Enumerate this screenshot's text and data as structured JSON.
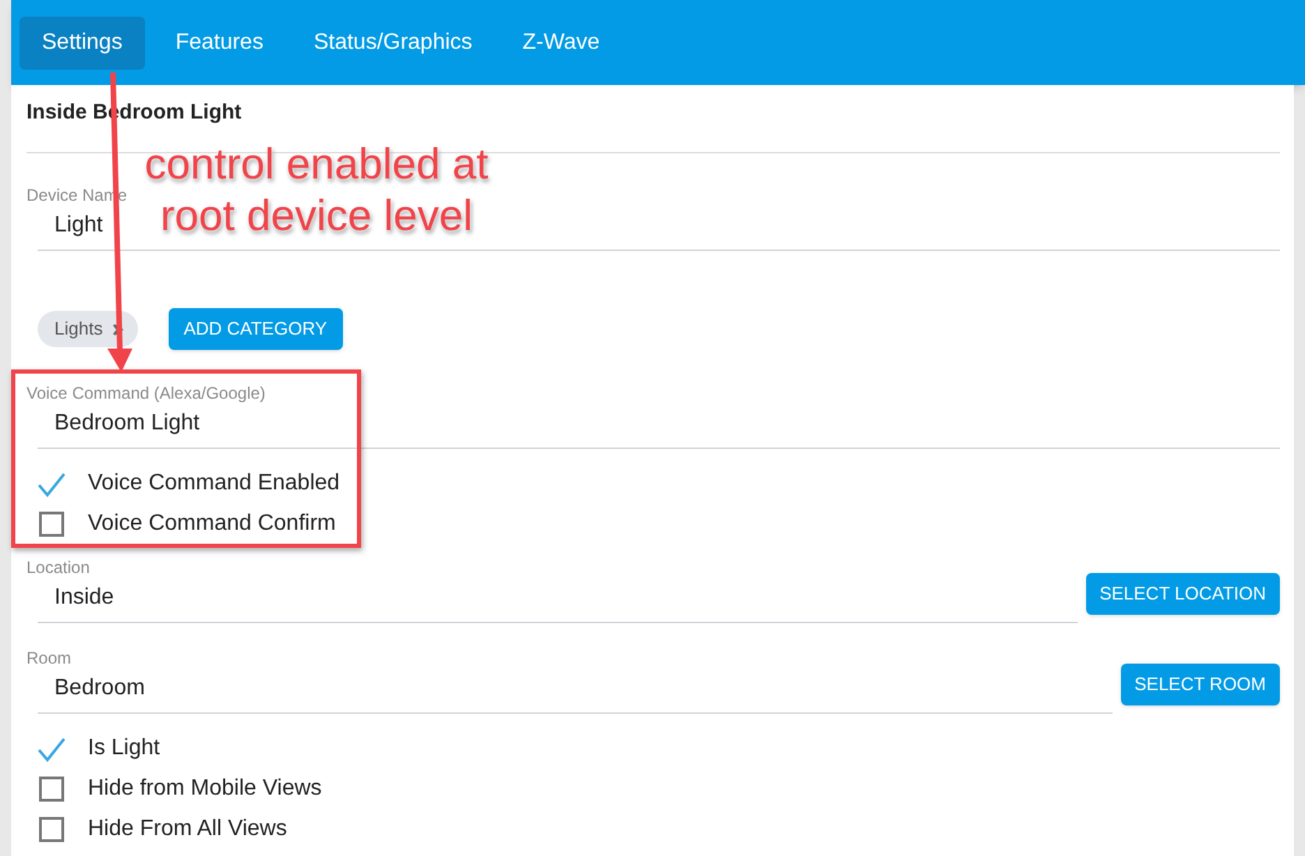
{
  "tabs": [
    {
      "label": "Settings",
      "selected": true
    },
    {
      "label": "Features",
      "selected": false
    },
    {
      "label": "Status/Graphics",
      "selected": false
    },
    {
      "label": "Z-Wave",
      "selected": false
    }
  ],
  "title": "Inside Bedroom Light",
  "form": [
    {
      "kind": "field",
      "label": "Device Name",
      "value": "Light"
    },
    {
      "kind": "categories",
      "chips": [
        "Lights"
      ],
      "button": "ADD CATEGORY"
    },
    {
      "kind": "field",
      "label": "Voice Command (Alexa/Google)",
      "value": "Bedroom Light"
    },
    {
      "kind": "checkbox",
      "label": "Voice Command Enabled",
      "checked": true
    },
    {
      "kind": "checkbox",
      "label": "Voice Command Confirm",
      "checked": false
    },
    {
      "kind": "field",
      "label": "Location",
      "value": "Inside",
      "button": "SELECT LOCATION"
    },
    {
      "kind": "field",
      "label": "Room",
      "value": "Bedroom",
      "button": "SELECT ROOM"
    },
    {
      "kind": "checkbox",
      "label": "Is Light",
      "checked": true
    },
    {
      "kind": "checkbox",
      "label": "Hide from Mobile Views",
      "checked": false
    },
    {
      "kind": "checkbox",
      "label": "Hide From All Views",
      "checked": false
    }
  ],
  "annotation": {
    "text": "control enabled at root device level"
  }
}
